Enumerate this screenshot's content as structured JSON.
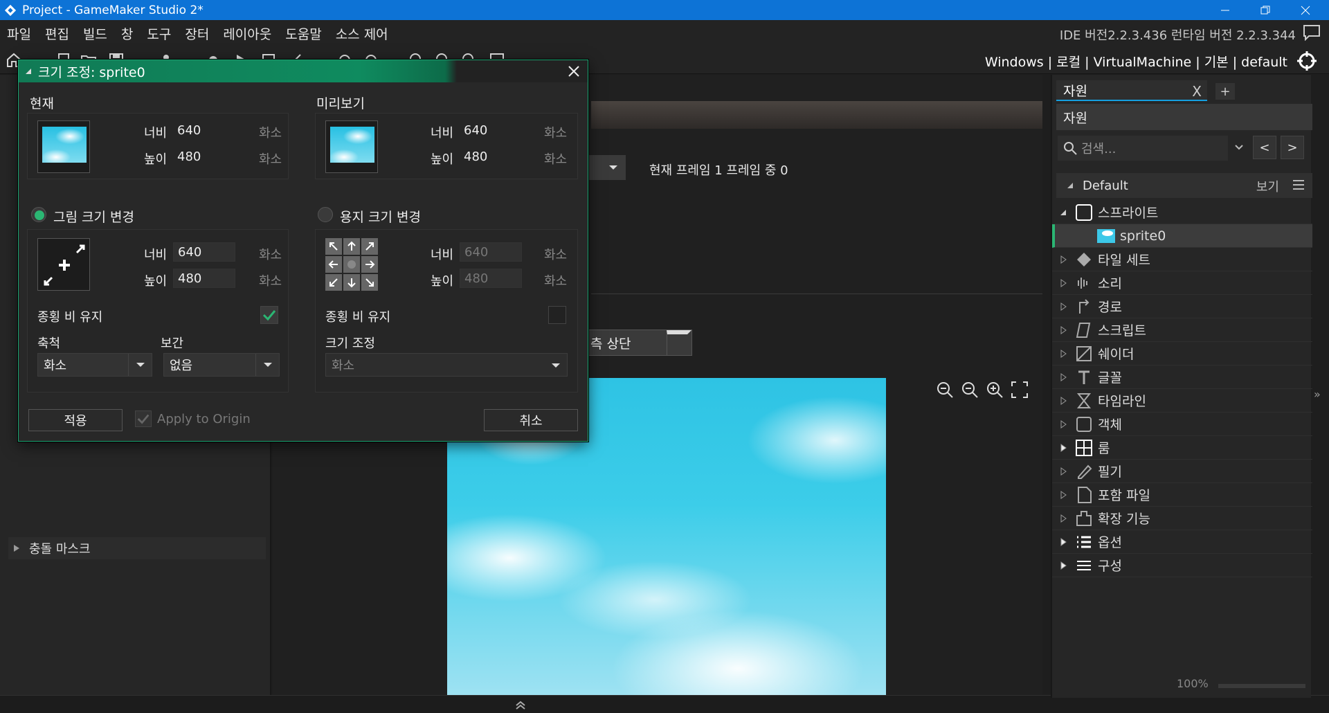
{
  "titlebar": {
    "title": "Project - GameMaker Studio 2*"
  },
  "menu": [
    "파일",
    "편집",
    "빌드",
    "창",
    "도구",
    "장터",
    "레이아웃",
    "도움말",
    "소스 제어"
  ],
  "ide_version": "IDE 버전2.2.3.436 런타임 버전 2.2.3.344",
  "targets": "Windows | 로컬 | VirtualMachine | 기본 | default",
  "left_panel": {
    "collision_mask": "충돌 마스크"
  },
  "workspace": {
    "frame_label": "현재 프레임 1 프레임 중 0",
    "origin_value": "측 상단"
  },
  "resources": {
    "tab_label": "자원",
    "tab_close": "X",
    "tab_add": "+",
    "header": "자원",
    "search_placeholder": "검색...",
    "nav_prev": "<",
    "nav_next": ">",
    "default_label": "Default",
    "view_label": "보기",
    "tree": [
      {
        "label": "스프라이트",
        "icon": "sprite-folder-icon",
        "expanded": true
      },
      {
        "label": "sprite0",
        "icon": "sprite-thumb-icon",
        "selected": true,
        "child": true
      },
      {
        "label": "타일 세트",
        "icon": "tileset-icon"
      },
      {
        "label": "소리",
        "icon": "sound-icon"
      },
      {
        "label": "경로",
        "icon": "path-icon"
      },
      {
        "label": "스크립트",
        "icon": "script-icon"
      },
      {
        "label": "쉐이더",
        "icon": "shader-icon"
      },
      {
        "label": "글꼴",
        "icon": "font-icon"
      },
      {
        "label": "타임라인",
        "icon": "timeline-icon"
      },
      {
        "label": "객체",
        "icon": "object-icon"
      },
      {
        "label": "룸",
        "icon": "room-icon"
      },
      {
        "label": "필기",
        "icon": "notes-icon"
      },
      {
        "label": "포함 파일",
        "icon": "included-files-icon"
      },
      {
        "label": "확장 기능",
        "icon": "extensions-icon"
      },
      {
        "label": "옵션",
        "icon": "options-icon"
      },
      {
        "label": "구성",
        "icon": "configs-icon"
      }
    ],
    "zoom_pct": "100%"
  },
  "dialog": {
    "title": "크기 조정: sprite0",
    "current": {
      "label": "현재",
      "width_label": "너비",
      "width": "640",
      "height_label": "높이",
      "height": "480",
      "unit": "화소"
    },
    "preview": {
      "label": "미리보기",
      "width_label": "너비",
      "width": "640",
      "height_label": "높이",
      "height": "480",
      "unit": "화소"
    },
    "image_resize": {
      "label": "그림 크기 변경",
      "width_label": "너비",
      "width": "640",
      "height_label": "높이",
      "height": "480",
      "unit": "화소",
      "keep_aspect": "종횡 비 유지",
      "scale_label": "축척",
      "scale_value": "화소",
      "interp_label": "보간",
      "interp_value": "없음"
    },
    "canvas_resize": {
      "label": "용지 크기 변경",
      "width_label": "너비",
      "width": "640",
      "height_label": "높이",
      "height": "480",
      "unit": "화소",
      "keep_aspect": "종횡 비 유지",
      "resize_label": "크기 조정",
      "resize_value": "화소"
    },
    "apply": "적용",
    "apply_origin": "Apply to Origin",
    "cancel": "취소"
  },
  "colors": {
    "titlebar": "#0d73d6",
    "dialog_accent": "#0f8b5f",
    "selection": "#2bb673"
  }
}
